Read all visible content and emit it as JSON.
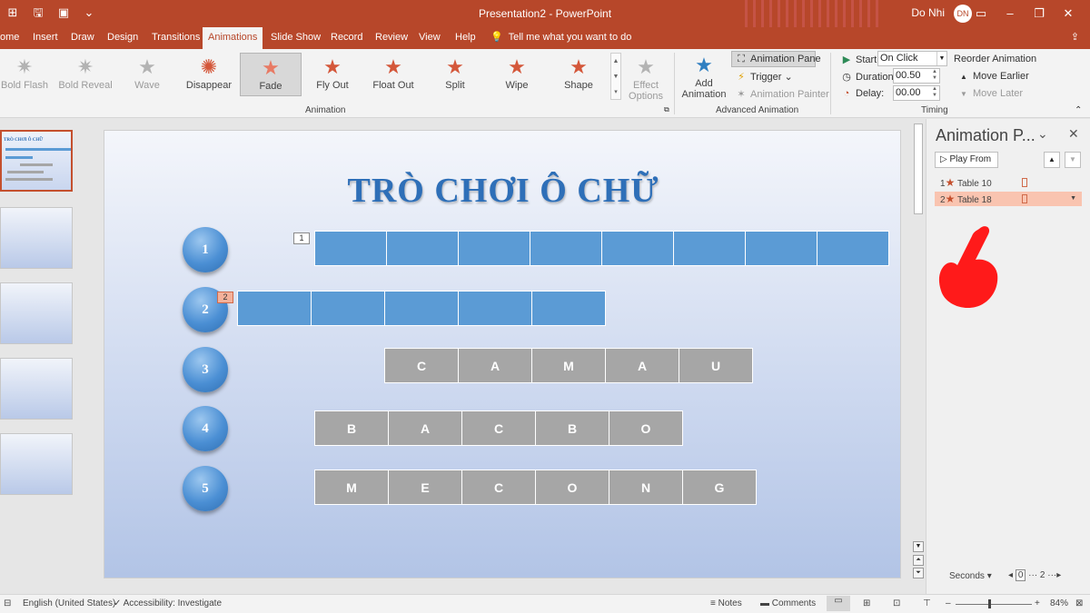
{
  "titlebar": {
    "document_title": "Presentation2  -  PowerPoint",
    "user_name": "Do Nhi",
    "user_initials": "DN"
  },
  "tabs": [
    {
      "label": "ome"
    },
    {
      "label": "Insert"
    },
    {
      "label": "Draw"
    },
    {
      "label": "Design"
    },
    {
      "label": "Transitions"
    },
    {
      "label": "Animations"
    },
    {
      "label": "Slide Show"
    },
    {
      "label": "Record"
    },
    {
      "label": "Review"
    },
    {
      "label": "View"
    },
    {
      "label": "Help"
    }
  ],
  "tell_me": "Tell me what you want to do",
  "ribbon": {
    "animations": [
      {
        "label": "Bold Flash",
        "state": "disabled"
      },
      {
        "label": "Bold Reveal",
        "state": "disabled"
      },
      {
        "label": "Wave",
        "state": "disabled"
      },
      {
        "label": "Disappear",
        "state": "normal"
      },
      {
        "label": "Fade",
        "state": "selected"
      },
      {
        "label": "Fly Out",
        "state": "normal"
      },
      {
        "label": "Float Out",
        "state": "normal"
      },
      {
        "label": "Split",
        "state": "normal"
      },
      {
        "label": "Wipe",
        "state": "normal"
      },
      {
        "label": "Shape",
        "state": "normal"
      }
    ],
    "effect_options_1": "Effect",
    "effect_options_2": "Options",
    "group_animation": "Animation",
    "add_animation_1": "Add",
    "add_animation_2": "Animation",
    "animation_pane": "Animation Pane",
    "trigger": "Trigger",
    "animation_painter": "Animation Painter",
    "group_advanced": "Advanced Animation",
    "start_label": "Start:",
    "start_value": "On Click",
    "duration_label": "Duration:",
    "duration_value": "00.50",
    "delay_label": "Delay:",
    "delay_value": "00.00",
    "reorder_title": "Reorder Animation",
    "move_earlier": "Move Earlier",
    "move_later": "Move Later",
    "group_timing": "Timing"
  },
  "thumbnail": {
    "title": "TRÒ CHƠI Ô CHỮ"
  },
  "slide": {
    "title": "TRÒ CHƠI Ô CHỮ",
    "rows": [
      {
        "number": "1",
        "tag": "1",
        "cells": [
          "",
          "",
          "",
          "",
          "",
          "",
          "",
          ""
        ]
      },
      {
        "number": "2",
        "tag": "2",
        "cells": [
          "",
          "",
          "",
          "",
          ""
        ]
      },
      {
        "number": "3",
        "cells": [
          "C",
          "A",
          "M",
          "A",
          "U"
        ]
      },
      {
        "number": "4",
        "cells": [
          "B",
          "A",
          "C",
          "B",
          "O"
        ]
      },
      {
        "number": "5",
        "cells": [
          "M",
          "E",
          "C",
          "O",
          "N",
          "G"
        ]
      }
    ]
  },
  "pane": {
    "title": "Animation P...",
    "play_from": "Play From",
    "items": [
      {
        "index": "1",
        "label": "Table 10"
      },
      {
        "index": "2",
        "label": "Table 18"
      }
    ],
    "seconds": "Seconds",
    "timeline_start": "0",
    "timeline_mark": "2"
  },
  "status": {
    "language": "English (United States)",
    "accessibility": "Accessibility: Investigate",
    "notes": "Notes",
    "comments": "Comments",
    "zoom": "84%"
  },
  "colors": {
    "accent": "#b7472a",
    "cell_blue": "#5b9bd5",
    "cell_grey": "#a6a6a6",
    "title_blue": "#2e6fb8",
    "hand_red": "#ff1a1a"
  }
}
